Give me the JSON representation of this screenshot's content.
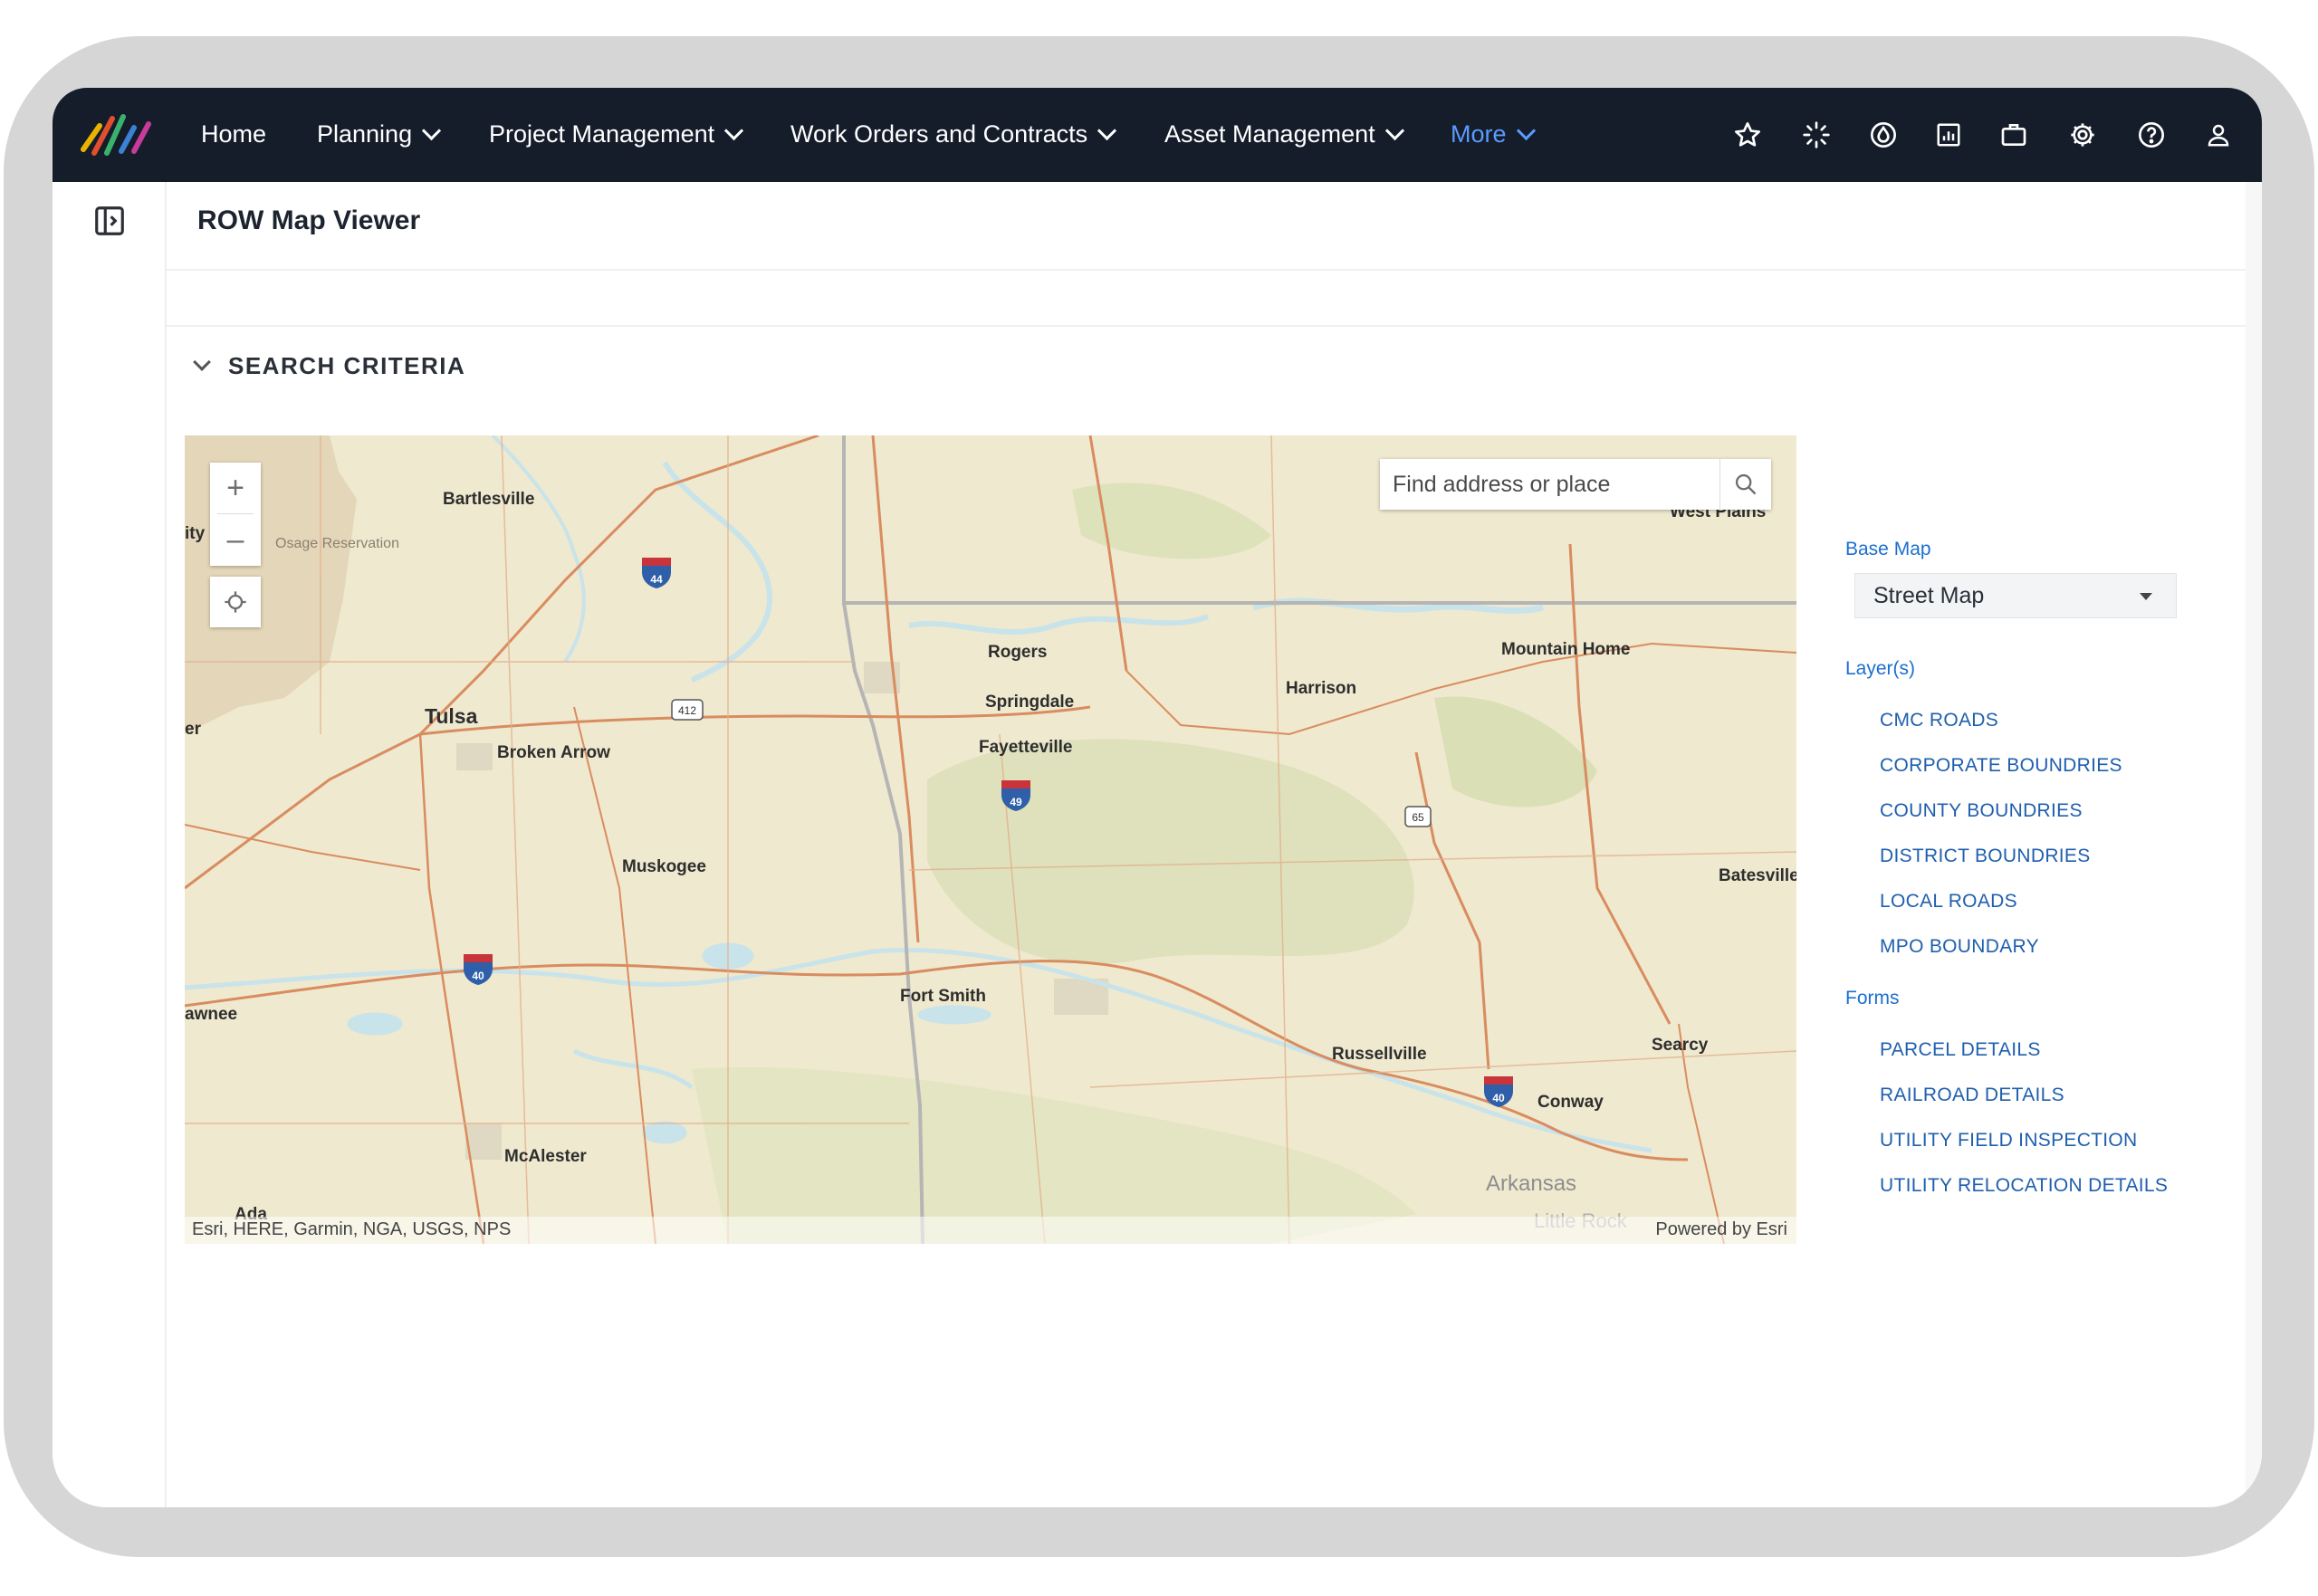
{
  "nav": {
    "items": [
      {
        "label": "Home"
      },
      {
        "label": "Planning"
      },
      {
        "label": "Project Management"
      },
      {
        "label": "Work Orders and Contracts"
      },
      {
        "label": "Asset Management"
      },
      {
        "label": "More"
      }
    ],
    "icons": [
      "star-icon",
      "loading-spinner-icon",
      "drop-icon",
      "report-icon",
      "briefcase-icon",
      "gear-icon",
      "help-icon",
      "user-icon"
    ]
  },
  "page": {
    "title": "ROW Map Viewer",
    "search_criteria_label": "SEARCH CRITERIA"
  },
  "map": {
    "search_placeholder": "Find address or place",
    "zoom_in": "+",
    "zoom_out": "–",
    "attribution_left": "Esri, HERE, Garmin, NGA, USGS, NPS",
    "attribution_right": "Powered by Esri",
    "place_labels": {
      "bartlesville": "Bartlesville",
      "osage": "Osage Reservation",
      "tulsa": "Tulsa",
      "broken_arrow": "Broken Arrow",
      "muskogee": "Muskogee",
      "mcalester": "McAlester",
      "ada": "Ada",
      "rogers": "Rogers",
      "springdale": "Springdale",
      "fayetteville": "Fayetteville",
      "harrison": "Harrison",
      "mountain_home": "Mountain Home",
      "batesville": "Batesville",
      "fort_smith": "Fort Smith",
      "russellville": "Russellville",
      "searcy": "Searcy",
      "conway": "Conway",
      "arkansas": "Arkansas",
      "little_rock": "Little Rock",
      "pawnee": "awnee",
      "city_fragment": "ity",
      "er_fragment": "er",
      "west_plains": "West Plains"
    },
    "shields": {
      "i44": "44",
      "i40_west": "40",
      "i49": "49",
      "i40_east": "40",
      "us412": "412",
      "us65": "65"
    }
  },
  "side_panel": {
    "base_map_label": "Base Map",
    "base_map_value": "Street Map",
    "layers_label": "Layer(s)",
    "layers": [
      "CMC ROADS",
      "CORPORATE BOUNDRIES",
      "COUNTY BOUNDRIES",
      "DISTRICT BOUNDRIES",
      "LOCAL ROADS",
      "MPO BOUNDARY"
    ],
    "forms_label": "Forms",
    "forms": [
      "PARCEL DETAILS",
      "RAILROAD DETAILS",
      "UTILITY FIELD INSPECTION",
      "UTILITY RELOCATION DETAILS"
    ]
  },
  "colors": {
    "nav_bg": "#151d2b",
    "nav_active": "#5a9bff",
    "link": "#1f5fae",
    "section_label": "#1c6fd0",
    "map_land": "#efe9cf",
    "map_water": "#c9e3ea",
    "map_road": "#d98c5f"
  }
}
